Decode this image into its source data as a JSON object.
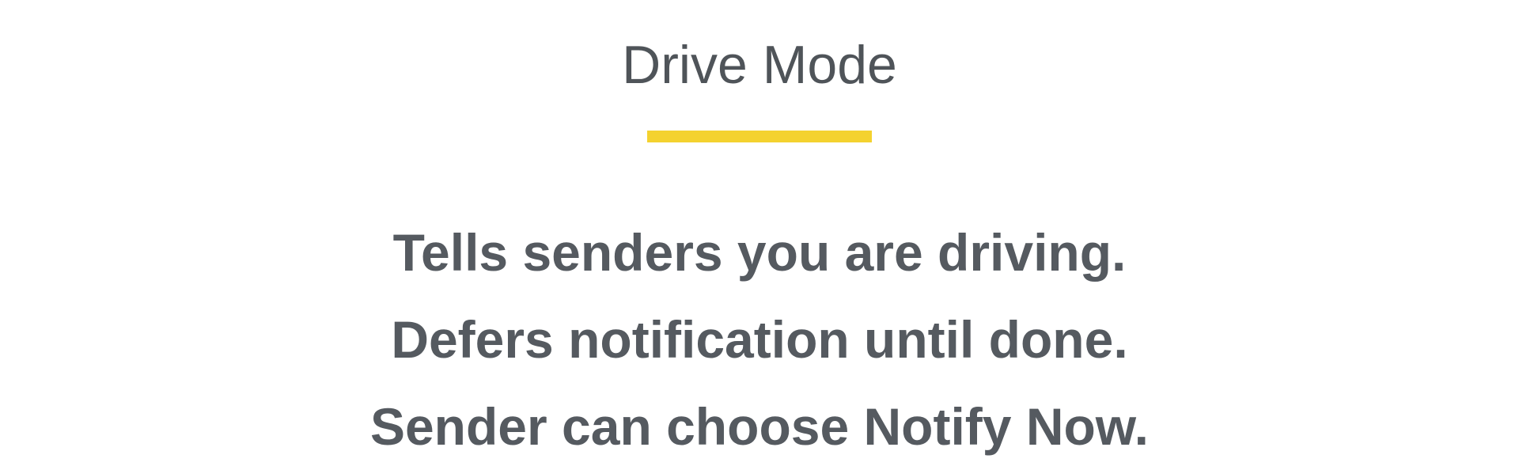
{
  "header": {
    "title": "Drive Mode"
  },
  "colors": {
    "accent": "#f4d22f",
    "text": "#555a60",
    "background": "#ffffff"
  },
  "features": [
    "Tells senders you are driving.",
    "Defers notification until done.",
    "Sender can choose Notify Now."
  ]
}
